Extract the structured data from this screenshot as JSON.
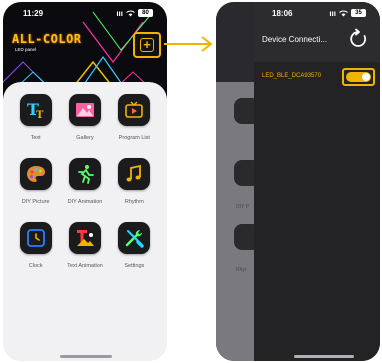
{
  "left_screen": {
    "status": {
      "time": "11:29",
      "signal": "ııı",
      "battery": "80"
    },
    "logo": {
      "title": "ALL-COLOR",
      "subtitle": "LED panel"
    },
    "add_button": "+",
    "menu": [
      {
        "label": "Text",
        "icon": "text-icon"
      },
      {
        "label": "Gallery",
        "icon": "gallery-icon"
      },
      {
        "label": "Program List",
        "icon": "program-list-icon"
      },
      {
        "label": "DIY Picture",
        "icon": "palette-icon"
      },
      {
        "label": "DIY Animation",
        "icon": "runner-icon"
      },
      {
        "label": "Rhythm",
        "icon": "music-note-icon"
      },
      {
        "label": "Clock",
        "icon": "clock-icon"
      },
      {
        "label": "Text Animation",
        "icon": "text-animation-icon"
      },
      {
        "label": "Settings",
        "icon": "settings-icon"
      }
    ]
  },
  "right_screen": {
    "status": {
      "time": "18:06",
      "signal": "ııı",
      "battery": "35"
    },
    "title": "Device Connecti...",
    "device": {
      "name": "LED_BLE_DCA93570",
      "connected": true
    },
    "behind_labels": [
      "DIY P",
      "Rhyt"
    ]
  },
  "colors": {
    "accent": "#f0b400",
    "dark": "#1b1b1d",
    "background": "#f1f1f3"
  }
}
